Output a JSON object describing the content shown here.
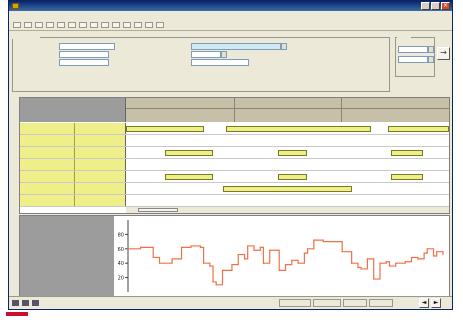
{
  "window": {
    "title": ""
  },
  "menu": {
    "items": [
      "",
      "",
      "",
      "",
      "",
      "",
      "",
      "",
      "",
      ""
    ]
  },
  "toolbar": {
    "button_count": 14
  },
  "filter": {
    "legend": "",
    "fields": [
      {
        "label": "",
        "value": ""
      },
      {
        "label": "",
        "value": ""
      },
      {
        "label": "",
        "value": ""
      },
      {
        "label": "",
        "value": ""
      },
      {
        "label": "",
        "value": ""
      },
      {
        "label": "",
        "value": ""
      }
    ],
    "pct1": "",
    "pct2": "",
    "pct3": "",
    "note": ""
  },
  "dates": {
    "legend": "",
    "from": "",
    "to": ""
  },
  "gantt": {
    "resource_header": "",
    "periods": [
      "",
      "",
      ""
    ],
    "rows": [
      {
        "c1": "",
        "c2": ""
      },
      {
        "c1": "",
        "c2": ""
      },
      {
        "c1": "",
        "c2": ""
      },
      {
        "c1": "",
        "c2": ""
      },
      {
        "c1": "",
        "c2": ""
      },
      {
        "c1": "",
        "c2": ""
      },
      {
        "c1": "",
        "c2": ""
      }
    ],
    "bars": [
      {
        "row": 0,
        "start": 0.0,
        "end": 0.24,
        "label": ""
      },
      {
        "row": 0,
        "start": 0.31,
        "end": 0.76,
        "label": ""
      },
      {
        "row": 0,
        "start": 0.81,
        "end": 1.0,
        "label": ""
      },
      {
        "row": 2,
        "start": 0.12,
        "end": 0.27,
        "label": ""
      },
      {
        "row": 2,
        "start": 0.47,
        "end": 0.56,
        "label": ""
      },
      {
        "row": 2,
        "start": 0.82,
        "end": 0.92,
        "label": ""
      },
      {
        "row": 4,
        "start": 0.12,
        "end": 0.27,
        "label": ""
      },
      {
        "row": 4,
        "start": 0.47,
        "end": 0.56,
        "label": ""
      },
      {
        "row": 4,
        "start": 0.82,
        "end": 0.92,
        "label": ""
      },
      {
        "row": 5,
        "start": 0.3,
        "end": 0.7,
        "label": ""
      }
    ]
  },
  "chart_data": {
    "type": "line",
    "ylim": [
      0,
      100
    ],
    "yticks": [
      20,
      40,
      60,
      80
    ],
    "line_color": "#f07048",
    "x": [
      0,
      4,
      8,
      10,
      14,
      17,
      20,
      23,
      24,
      26,
      27,
      28,
      30,
      33,
      35,
      37,
      38,
      40,
      42,
      43,
      45,
      48,
      50,
      52,
      54,
      56,
      57,
      59,
      62,
      66,
      68,
      71,
      73,
      74,
      76,
      78,
      80,
      82,
      83,
      85,
      88,
      90,
      92,
      94,
      95,
      97,
      98,
      100
    ],
    "values": [
      60,
      62,
      48,
      40,
      46,
      62,
      64,
      62,
      40,
      36,
      14,
      10,
      30,
      38,
      52,
      46,
      64,
      58,
      62,
      40,
      58,
      30,
      38,
      44,
      40,
      54,
      60,
      72,
      70,
      70,
      56,
      40,
      34,
      32,
      46,
      18,
      40,
      42,
      36,
      40,
      42,
      48,
      46,
      54,
      60,
      50,
      56,
      52
    ]
  },
  "status": {
    "segments": [
      "",
      "",
      "",
      "",
      ""
    ]
  },
  "colors": {
    "title_bar": "#0a246a",
    "resource_cell": "#efef8a",
    "timeline_header": "#c6c0a8",
    "line": "#f07048",
    "mark": "#c8102e"
  },
  "icons": {
    "nav_first": "◄",
    "nav_last": "►",
    "goto": "→",
    "close": "×",
    "combo": "▾"
  }
}
